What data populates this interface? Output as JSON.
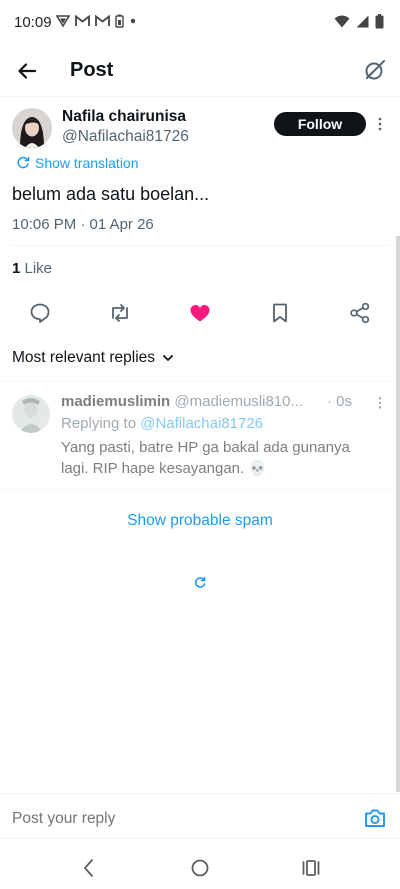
{
  "status_bar": {
    "time": "10:09",
    "icons_left": [
      "vpn-shield-icon",
      "gmail-icon",
      "gmail-icon",
      "battery-saver-icon",
      "dot-icon"
    ],
    "icons_right": [
      "wifi-icon",
      "signal-icon",
      "battery-icon"
    ]
  },
  "header": {
    "title": "Post",
    "back_icon": "arrow-left-icon",
    "right_icon": "grok-icon"
  },
  "post": {
    "author_name": "Nafila chairunisa",
    "author_handle": "@Nafilachai81726",
    "follow_label": "Follow",
    "translate_label": "Show translation",
    "text": "belum ada satu boelan...",
    "timestamp": "10:06 PM · 01 Apr 26",
    "like_count": "1",
    "like_label": " Like",
    "actions": [
      "reply-icon",
      "retweet-icon",
      "like-filled-icon",
      "bookmark-icon",
      "share-icon"
    ],
    "like_color": "#f91880"
  },
  "replies_sort": {
    "label": "Most relevant replies"
  },
  "reply": {
    "name": "madiemuslimin",
    "handle": "@madiemusli810...",
    "time": "· 0s",
    "replying_prefix": "Replying to ",
    "replying_mention": "@Nafilachai81726",
    "text": "Yang pasti, batre HP ga bakal ada gunanya lagi. RIP hape kesayangan. 💀"
  },
  "spam_link": "Show probable spam",
  "compose": {
    "placeholder": "Post your reply"
  },
  "colors": {
    "accent": "#1d9bf0",
    "text": "#0f1419",
    "secondary": "#536471"
  }
}
